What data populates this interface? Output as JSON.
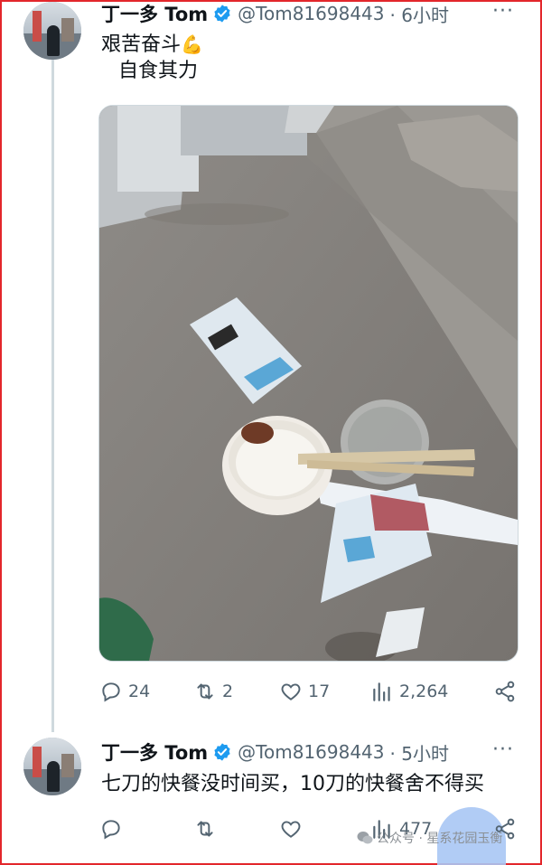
{
  "tweet1": {
    "display_name": "丁一多 Tom",
    "handle": "@Tom81698443",
    "time": "· 6小时",
    "text_line1": "艰苦奋斗",
    "emoji": "💪",
    "text_line2": "自食其力",
    "replies": "24",
    "retweets": "2",
    "likes": "17",
    "views": "2,264"
  },
  "tweet2": {
    "display_name": "丁一多 Tom",
    "handle": "@Tom81698443",
    "time": "· 5小时",
    "text": "七刀的快餐没时间买，10刀的快餐舍不得买",
    "views": "477"
  },
  "more_symbol": "···",
  "watermark": "公众号 · 星系花园玉衡",
  "colors": {
    "verified": "#1d9bf0",
    "frame": "#e3262b",
    "secondary_text": "#536471"
  },
  "icons": [
    "reply-icon",
    "retweet-icon",
    "like-icon",
    "views-icon",
    "share-icon",
    "verified-badge-icon",
    "more-icon",
    "wechat-icon"
  ]
}
